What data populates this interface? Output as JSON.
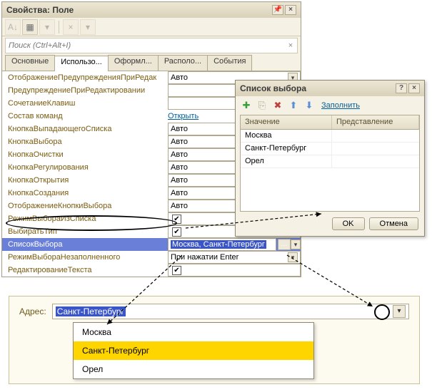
{
  "propWindow": {
    "title": "Свойства: Поле",
    "searchPlaceholder": "Поиск (Ctrl+Alt+I)",
    "tabs": [
      "Основные",
      "Использо...",
      "Оформл...",
      "Располо...",
      "События"
    ],
    "activeTab": 1,
    "rows": [
      {
        "label": "ОтображениеПредупрежденияПриРедак",
        "value": "Авто",
        "type": "dd"
      },
      {
        "label": "ПредупреждениеПриРедактировании",
        "value": "",
        "type": "text"
      },
      {
        "label": "СочетаниеКлавиш",
        "value": "",
        "type": "text"
      },
      {
        "label": "Состав команд",
        "value": "Открыть",
        "type": "link"
      },
      {
        "label": "КнопкаВыпадающегоСписка",
        "value": "Авто",
        "type": "dd"
      },
      {
        "label": "КнопкаВыбора",
        "value": "Авто",
        "type": "dd"
      },
      {
        "label": "КнопкаОчистки",
        "value": "Авто",
        "type": "dd"
      },
      {
        "label": "КнопкаРегулирования",
        "value": "Авто",
        "type": "dd"
      },
      {
        "label": "КнопкаОткрытия",
        "value": "Авто",
        "type": "dd"
      },
      {
        "label": "КнопкаСоздания",
        "value": "Авто",
        "type": "dd"
      },
      {
        "label": "ОтображениеКнопкиВыбора",
        "value": "Авто",
        "type": "dd"
      },
      {
        "label": "РежимВыбораИзСписка",
        "checked": true,
        "type": "chk"
      },
      {
        "label": "ВыбиратьТип",
        "checked": true,
        "type": "chk"
      },
      {
        "label": "СписокВыбора",
        "value": "Москва, Санкт-Петербург",
        "type": "ell",
        "selected": true
      },
      {
        "label": "РежимВыбораНезаполненного",
        "value": "При нажатии Enter",
        "type": "dd"
      },
      {
        "label": "РедактированиеТекста",
        "checked": true,
        "type": "chk"
      }
    ]
  },
  "listDialog": {
    "title": "Список выбора",
    "fillLabel": "Заполнить",
    "headers": [
      "Значение",
      "Представление"
    ],
    "items": [
      "Москва",
      "Санкт-Петербург",
      "Орел"
    ],
    "ok": "OK",
    "cancel": "Отмена"
  },
  "address": {
    "label": "Адрес:",
    "value": "Санкт-Петербург",
    "options": [
      "Москва",
      "Санкт-Петербург",
      "Орел"
    ],
    "activeIndex": 1
  }
}
